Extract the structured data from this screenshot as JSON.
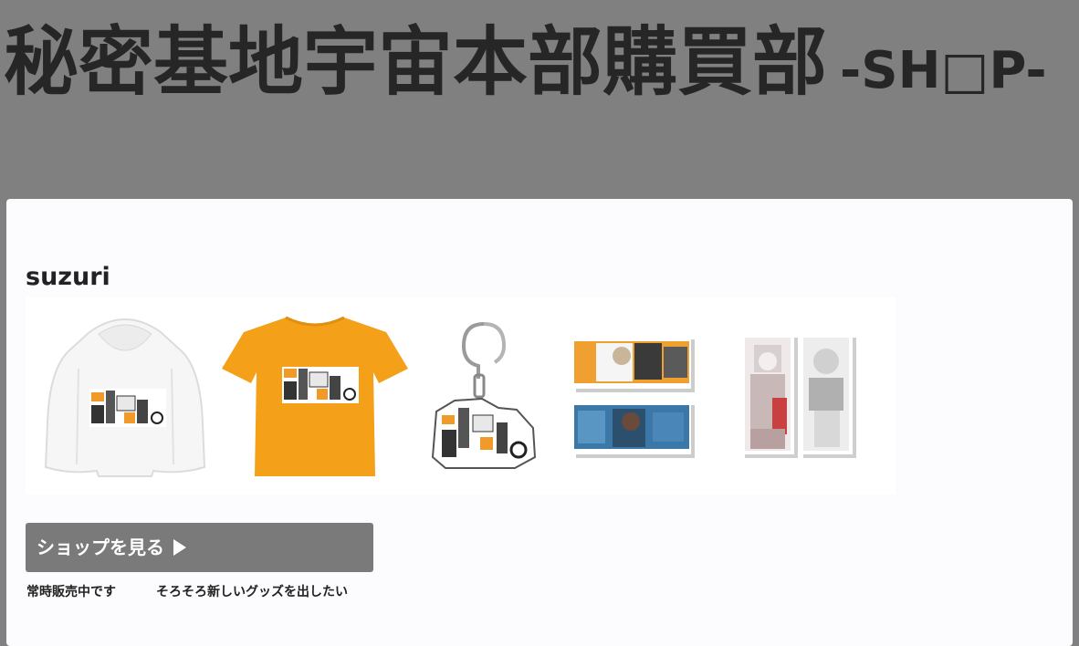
{
  "header": {
    "title_main": "秘密基地宇宙本部購買部",
    "title_sub": "-SH□P-"
  },
  "section": {
    "title": "suzuri",
    "products": [
      {
        "name": "hoodie",
        "color": "#ffffff"
      },
      {
        "name": "t-shirt",
        "color": "#f4a018"
      },
      {
        "name": "acrylic-keychain",
        "color": "#ffffff"
      },
      {
        "name": "sticker-set",
        "color": "#f0a030"
      },
      {
        "name": "bookmark-set",
        "color": "#ffffff"
      }
    ],
    "button_label": "ショップを見る",
    "notes": [
      "常時販売中です",
      "そろそろ新しいグッズを出したい"
    ]
  },
  "colors": {
    "page_background": "#808080",
    "card_background": "#fcfbfd",
    "button_background": "#7a7a7a",
    "text": "#222222"
  }
}
